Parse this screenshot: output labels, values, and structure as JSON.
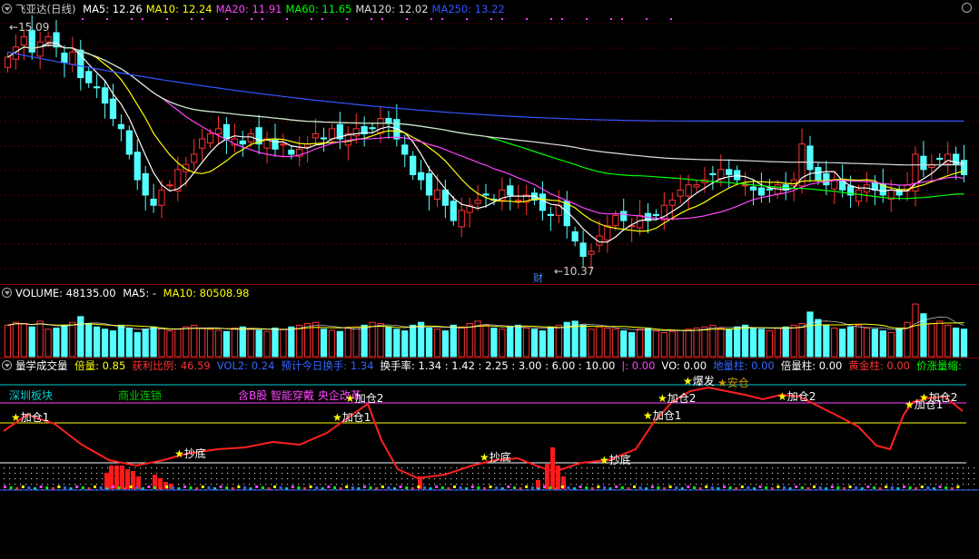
{
  "main": {
    "title": "飞亚达(日线)",
    "ma": [
      {
        "label": "MA5: 12.26",
        "color": "#ffffff"
      },
      {
        "label": "MA10: 12.24",
        "color": "#ffff00"
      },
      {
        "label": "MA20: 11.91",
        "color": "#ff44ff"
      },
      {
        "label": "MA60: 11.65",
        "color": "#00ff00"
      },
      {
        "label": "MA120: 12.02",
        "color": "#dddddd"
      },
      {
        "label": "MA250: 13.22",
        "color": "#3355ff"
      }
    ],
    "high_label": "15.09",
    "low_label": "10.37",
    "finance_marker": "财"
  },
  "volume": {
    "label": "VOLUME: 48135.00",
    "ma5": "MA5: -",
    "ma10": "MA10: 80508.98"
  },
  "indicator": {
    "name": "量学成交量",
    "fields": [
      {
        "label": "倍量: 0.85",
        "color": "#ffff00"
      },
      {
        "label": "获利比例: 46.59",
        "color": "#ff3333"
      },
      {
        "label": "VOL2: 0.24",
        "color": "#3366ff"
      },
      {
        "label": "预计今日换手: 1.34",
        "color": "#3366ff"
      },
      {
        "label": "换手率: 1.34 : 1.42 : 2.25 : 3.00 : 6.00 : 10.00",
        "color": "#ffffff"
      },
      {
        "label": "|: 0.00",
        "color": "#ff44ff"
      },
      {
        "label": "VO: 0.00",
        "color": "#ffffff"
      },
      {
        "label": "地量柱: 0.00",
        "color": "#3366ff"
      },
      {
        "label": "倍量柱: 0.00",
        "color": "#ffffff"
      },
      {
        "label": "黄金柱: 0.00",
        "color": "#ff3333"
      },
      {
        "label": "价涨量缩:",
        "color": "#00ff00"
      }
    ],
    "tags": [
      {
        "text": "深圳板块",
        "color": "#00cccc"
      },
      {
        "text": "商业连锁",
        "color": "#00cc00"
      },
      {
        "text": "含B股 智能穿戴 央企改革",
        "color": "#ff44ff"
      }
    ],
    "markers": [
      {
        "text": "加仓1",
        "color": "#ffffff"
      },
      {
        "text": "抄底",
        "color": "#ffffff"
      },
      {
        "text": "加仓1",
        "color": "#ffffff"
      },
      {
        "text": "加仓2",
        "color": "#ffffff"
      },
      {
        "text": "抄底",
        "color": "#ffffff"
      },
      {
        "text": "抄底",
        "color": "#ffffff"
      },
      {
        "text": "加仓1",
        "color": "#ffffff"
      },
      {
        "text": "加仓2",
        "color": "#ffffff"
      },
      {
        "text": "爆发",
        "color": "#ffffff"
      },
      {
        "text": "安仓",
        "color": "#cc9900"
      },
      {
        "text": "加仓2",
        "color": "#ffffff"
      },
      {
        "text": "加仓1",
        "color": "#ffffff"
      },
      {
        "text": "加仓2",
        "color": "#ffffff"
      }
    ]
  },
  "chart_data": {
    "type": "candlestick",
    "title": "飞亚达(日线)",
    "ylim": [
      10.2,
      15.3
    ],
    "high": 15.09,
    "low": 10.37,
    "ma_latest": {
      "MA5": 12.26,
      "MA10": 12.24,
      "MA20": 11.91,
      "MA60": 11.65,
      "MA120": 12.02,
      "MA250": 13.22
    },
    "close": [
      14.5,
      14.7,
      14.9,
      14.6,
      14.8,
      14.9,
      14.7,
      14.4,
      14.6,
      14.1,
      14.0,
      13.9,
      13.6,
      13.3,
      13.1,
      12.6,
      12.1,
      11.8,
      11.6,
      11.9,
      12.0,
      12.3,
      12.4,
      12.6,
      12.9,
      13.0,
      13.1,
      12.9,
      12.9,
      12.8,
      13.0,
      12.8,
      12.9,
      12.7,
      12.8,
      12.6,
      12.7,
      12.8,
      13.0,
      12.9,
      13.1,
      12.9,
      13.0,
      13.1,
      13.0,
      13.1,
      13.3,
      13.2,
      12.9,
      12.6,
      12.2,
      12.1,
      11.8,
      11.9,
      11.6,
      11.3,
      11.5,
      11.6,
      11.7,
      11.8,
      11.7,
      11.9,
      11.8,
      11.7,
      11.8,
      11.7,
      11.5,
      11.4,
      11.6,
      11.2,
      10.9,
      10.6,
      10.7,
      11.0,
      11.2,
      11.4,
      11.3,
      11.2,
      11.4,
      11.3,
      11.4,
      11.6,
      11.7,
      11.9,
      12.0,
      12.0,
      12.1,
      12.2,
      12.3,
      12.2,
      12.1,
      12.0,
      11.9,
      11.8,
      11.9,
      12.0,
      11.9,
      12.1,
      12.8,
      12.3,
      12.1,
      12.0,
      12.1,
      11.9,
      11.8,
      11.9,
      12.0,
      11.9,
      11.8,
      11.9,
      11.8,
      12.0,
      12.6,
      12.3,
      12.4,
      12.5,
      12.6,
      12.4,
      12.2
    ],
    "volume": [
      55,
      60,
      58,
      52,
      62,
      48,
      50,
      55,
      60,
      70,
      58,
      52,
      48,
      45,
      55,
      50,
      42,
      48,
      52,
      50,
      45,
      48,
      52,
      55,
      50,
      48,
      46,
      44,
      50,
      52,
      48,
      46,
      44,
      50,
      48,
      52,
      55,
      58,
      60,
      48,
      46,
      44,
      50,
      52,
      55,
      60,
      58,
      52,
      48,
      45,
      55,
      60,
      50,
      48,
      45,
      55,
      52,
      58,
      62,
      55,
      50,
      48,
      52,
      55,
      50,
      48,
      45,
      52,
      55,
      60,
      62,
      55,
      48,
      52,
      50,
      48,
      45,
      42,
      48,
      50,
      45,
      42,
      44,
      46,
      48,
      50,
      52,
      55,
      50,
      48,
      52,
      55,
      50,
      48,
      45,
      50,
      52,
      55,
      58,
      78,
      65,
      55,
      50,
      48,
      52,
      55,
      50,
      48,
      45,
      42,
      50,
      60,
      92,
      75,
      58,
      62,
      55,
      50,
      48
    ]
  }
}
